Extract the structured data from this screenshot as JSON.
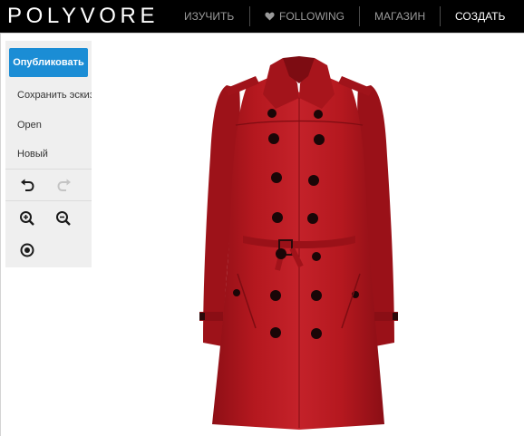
{
  "header": {
    "logo": "POLYVORE",
    "nav": {
      "explore": "ИЗУЧИТЬ",
      "following": "FOLLOWING",
      "shop": "МАГАЗИН",
      "create": "СОЗДАТЬ"
    }
  },
  "toolbar": {
    "publish_label": "Опубликовать",
    "save_draft_label": "Сохранить эскиз",
    "open_label": "Open",
    "new_label": "Новый",
    "tools": [
      "undo-icon",
      "redo-icon",
      "zoom-in-icon",
      "zoom-out-icon",
      "center-icon"
    ],
    "redo_enabled": false
  },
  "canvas": {
    "item": "trench-coat-image",
    "item_color": "#b5181f"
  },
  "colors": {
    "header_bg": "#000000",
    "accent": "#1b8dd5",
    "toolbar_bg": "#efefef"
  }
}
